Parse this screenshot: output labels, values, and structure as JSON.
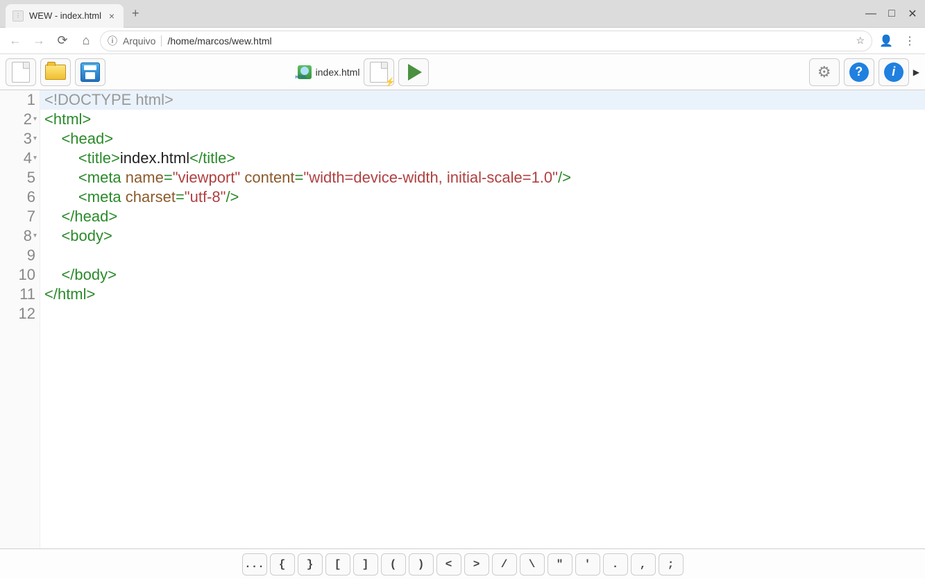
{
  "window": {
    "tab_title": "WEW - index.html"
  },
  "addressbar": {
    "source_label": "Arquivo",
    "path": "/home/marcos/wew.html"
  },
  "toolbar": {
    "filename": "index.html"
  },
  "code": {
    "lines": [
      {
        "n": "1",
        "fold": "",
        "segs": [
          {
            "c": "t-dt",
            "t": "<!DOCTYPE html>"
          }
        ],
        "active": true
      },
      {
        "n": "2",
        "fold": "▾",
        "segs": [
          {
            "c": "t-tag",
            "t": "<html>"
          }
        ]
      },
      {
        "n": "3",
        "fold": "▾",
        "segs": [
          {
            "c": "",
            "t": "    "
          },
          {
            "c": "t-tag",
            "t": "<head>"
          }
        ]
      },
      {
        "n": "4",
        "fold": "▾",
        "segs": [
          {
            "c": "",
            "t": "        "
          },
          {
            "c": "t-tag",
            "t": "<title>"
          },
          {
            "c": "t-txt",
            "t": "index.html"
          },
          {
            "c": "t-tag",
            "t": "</title>"
          }
        ]
      },
      {
        "n": "5",
        "fold": "",
        "segs": [
          {
            "c": "",
            "t": "        "
          },
          {
            "c": "t-tag",
            "t": "<meta "
          },
          {
            "c": "t-attr",
            "t": "name"
          },
          {
            "c": "t-tag",
            "t": "="
          },
          {
            "c": "t-str",
            "t": "\"viewport\""
          },
          {
            "c": "t-tag",
            "t": " "
          },
          {
            "c": "t-attr",
            "t": "content"
          },
          {
            "c": "t-tag",
            "t": "="
          },
          {
            "c": "t-str",
            "t": "\"width=device-width, initial-scale=1.0\""
          },
          {
            "c": "t-tag",
            "t": "/>"
          }
        ]
      },
      {
        "n": "6",
        "fold": "",
        "segs": [
          {
            "c": "",
            "t": "        "
          },
          {
            "c": "t-tag",
            "t": "<meta "
          },
          {
            "c": "t-attr",
            "t": "charset"
          },
          {
            "c": "t-tag",
            "t": "="
          },
          {
            "c": "t-str",
            "t": "\"utf-8\""
          },
          {
            "c": "t-tag",
            "t": "/>"
          }
        ]
      },
      {
        "n": "7",
        "fold": "",
        "segs": [
          {
            "c": "",
            "t": "    "
          },
          {
            "c": "t-tag",
            "t": "</head>"
          }
        ]
      },
      {
        "n": "8",
        "fold": "▾",
        "segs": [
          {
            "c": "",
            "t": "    "
          },
          {
            "c": "t-tag",
            "t": "<body>"
          }
        ]
      },
      {
        "n": "9",
        "fold": "",
        "segs": []
      },
      {
        "n": "10",
        "fold": "",
        "segs": [
          {
            "c": "",
            "t": "    "
          },
          {
            "c": "t-tag",
            "t": "</body>"
          }
        ]
      },
      {
        "n": "11",
        "fold": "",
        "segs": [
          {
            "c": "t-tag",
            "t": "</html>"
          }
        ]
      },
      {
        "n": "12",
        "fold": "",
        "segs": []
      }
    ]
  },
  "symbols": [
    "...",
    "{",
    "}",
    "[",
    "]",
    "(",
    ")",
    "<",
    ">",
    "/",
    "\\",
    "\"",
    "'",
    ".",
    ",",
    ";"
  ]
}
